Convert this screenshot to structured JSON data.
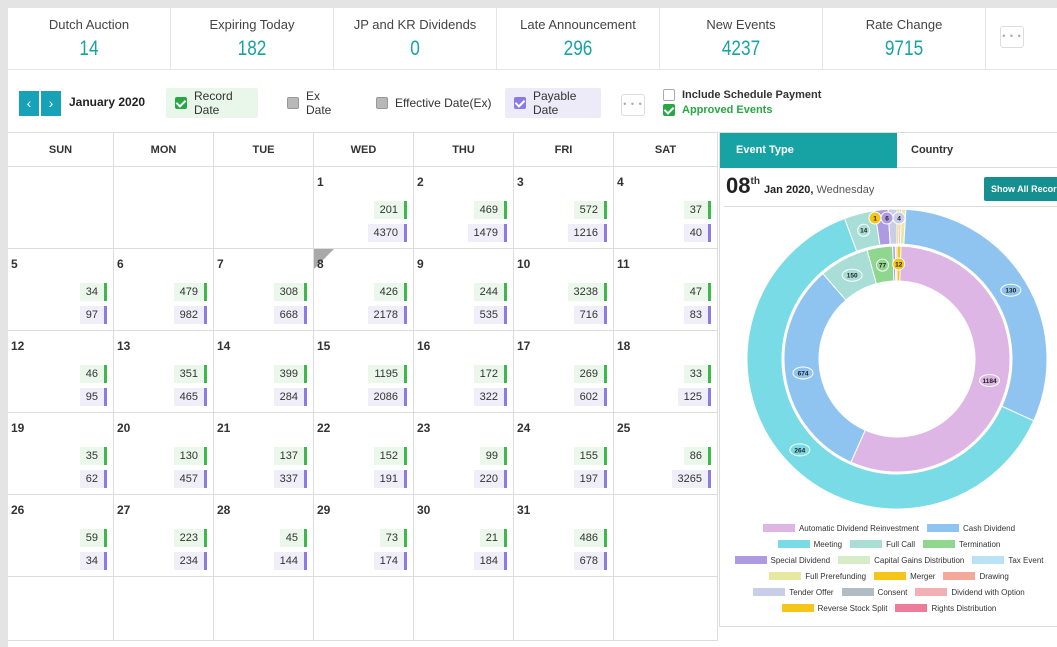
{
  "stats": [
    {
      "label": "Dutch Auction",
      "value": "14"
    },
    {
      "label": "Expiring Today",
      "value": "182"
    },
    {
      "label": "JP and KR Dividends",
      "value": "0"
    },
    {
      "label": "Late Announcement",
      "value": "296"
    },
    {
      "label": "New Events",
      "value": "4237"
    },
    {
      "label": "Rate Change",
      "value": "9715"
    }
  ],
  "more_dots": "• • •",
  "toolbar": {
    "prev": "‹",
    "next": "›",
    "month": "January 2020",
    "filters": [
      {
        "label": "Record Date",
        "checked": true
      },
      {
        "label": "Ex Date",
        "checked": false
      },
      {
        "label": "Effective Date(Ex)",
        "checked": false
      },
      {
        "label": "Payable Date",
        "checked": true
      }
    ],
    "include_schedule": "Include Schedule Payment",
    "approved_events": "Approved Events"
  },
  "calendar": {
    "weekdays": [
      "SUN",
      "MON",
      "TUE",
      "WED",
      "THU",
      "FRI",
      "SAT"
    ],
    "weeks": [
      [
        null,
        null,
        null,
        {
          "d": "1",
          "g": "201",
          "p": "4370"
        },
        {
          "d": "2",
          "g": "469",
          "p": "1479"
        },
        {
          "d": "3",
          "g": "572",
          "p": "1216"
        },
        {
          "d": "4",
          "g": "37",
          "p": "40"
        }
      ],
      [
        {
          "d": "5",
          "g": "34",
          "p": "97"
        },
        {
          "d": "6",
          "g": "479",
          "p": "982"
        },
        {
          "d": "7",
          "g": "308",
          "p": "668"
        },
        {
          "d": "8",
          "g": "426",
          "p": "2178"
        },
        {
          "d": "9",
          "g": "244",
          "p": "535"
        },
        {
          "d": "10",
          "g": "3238",
          "p": "716"
        },
        {
          "d": "11",
          "g": "47",
          "p": "83"
        }
      ],
      [
        {
          "d": "12",
          "g": "46",
          "p": "95"
        },
        {
          "d": "13",
          "g": "351",
          "p": "465"
        },
        {
          "d": "14",
          "g": "399",
          "p": "284"
        },
        {
          "d": "15",
          "g": "1195",
          "p": "2086"
        },
        {
          "d": "16",
          "g": "172",
          "p": "322"
        },
        {
          "d": "17",
          "g": "269",
          "p": "602"
        },
        {
          "d": "18",
          "g": "33",
          "p": "125"
        }
      ],
      [
        {
          "d": "19",
          "g": "35",
          "p": "62"
        },
        {
          "d": "20",
          "g": "130",
          "p": "457"
        },
        {
          "d": "21",
          "g": "137",
          "p": "337"
        },
        {
          "d": "22",
          "g": "152",
          "p": "191"
        },
        {
          "d": "23",
          "g": "99",
          "p": "220"
        },
        {
          "d": "24",
          "g": "155",
          "p": "197"
        },
        {
          "d": "25",
          "g": "86",
          "p": "3265"
        }
      ],
      [
        {
          "d": "26",
          "g": "59",
          "p": "34"
        },
        {
          "d": "27",
          "g": "223",
          "p": "234"
        },
        {
          "d": "28",
          "g": "45",
          "p": "144"
        },
        {
          "d": "29",
          "g": "73",
          "p": "174"
        },
        {
          "d": "30",
          "g": "21",
          "p": "184"
        },
        {
          "d": "31",
          "g": "486",
          "p": "678"
        },
        null
      ]
    ],
    "selected_day": "8"
  },
  "panel": {
    "tabs": [
      "Event Type",
      "Country"
    ],
    "date_day": "08",
    "date_suffix": "th",
    "date_rest": "Jan 2020,",
    "weekday": "Wednesday",
    "show_all": "Show All Records"
  },
  "chart_data": {
    "type": "pie",
    "subtype": "nested-donut",
    "outer_ring": [
      {
        "label": "1",
        "value": 1,
        "color": "#f5c518"
      },
      {
        "label": "",
        "value": 1,
        "color": "#f3b0b3"
      },
      {
        "label": "",
        "value": 2,
        "color": "#e8e8a0"
      },
      {
        "label": "130",
        "value": 130,
        "color": "#90c4f0"
      },
      {
        "label": "264",
        "value": 264,
        "color": "#78dbe6"
      },
      {
        "label": "14",
        "value": 14,
        "color": "#a9ded6"
      },
      {
        "label": "6",
        "value": 6,
        "color": "#ad9ae0"
      },
      {
        "label": "4",
        "value": 4,
        "color": "#c8cde8"
      }
    ],
    "inner_ring": [
      {
        "label": "12",
        "value": 12,
        "color": "#f5c518"
      },
      {
        "label": "1184",
        "value": 1184,
        "color": "#deb6e6"
      },
      {
        "label": "674",
        "value": 674,
        "color": "#90c4f0"
      },
      {
        "label": "150",
        "value": 150,
        "color": "#a9ded6"
      },
      {
        "label": "77",
        "value": 77,
        "color": "#8fd68f"
      },
      {
        "label": "",
        "value": 8,
        "color": "#ad9ae0"
      },
      {
        "label": "",
        "value": 5,
        "color": "#c8cde8"
      }
    ],
    "legend": [
      [
        {
          "name": "Automatic Dividend Reinvestment",
          "color": "#deb6e6"
        },
        {
          "name": "Cash Dividend",
          "color": "#90c4f0"
        }
      ],
      [
        {
          "name": "Meeting",
          "color": "#78dbe6"
        },
        {
          "name": "Full Call",
          "color": "#a9ded6"
        },
        {
          "name": "Termination",
          "color": "#8fd68f"
        }
      ],
      [
        {
          "name": "Special Dividend",
          "color": "#ad9ae0"
        },
        {
          "name": "Capital Gains Distribution",
          "color": "#d6ecc8"
        },
        {
          "name": "Tax Event",
          "color": "#b9e2f6"
        }
      ],
      [
        {
          "name": "Full Prerefunding",
          "color": "#e8e8a0"
        },
        {
          "name": "Merger",
          "color": "#f5c518"
        },
        {
          "name": "Drawing",
          "color": "#f4a89a"
        }
      ],
      [
        {
          "name": "Tender Offer",
          "color": "#c8cde8"
        },
        {
          "name": "Consent",
          "color": "#b2bcc4"
        },
        {
          "name": "Dividend with Option",
          "color": "#f3b0b3"
        }
      ],
      [
        {
          "name": "Reverse Stock Split",
          "color": "#f5c518"
        },
        {
          "name": "Rights Distribution",
          "color": "#ee7c98"
        }
      ]
    ]
  }
}
